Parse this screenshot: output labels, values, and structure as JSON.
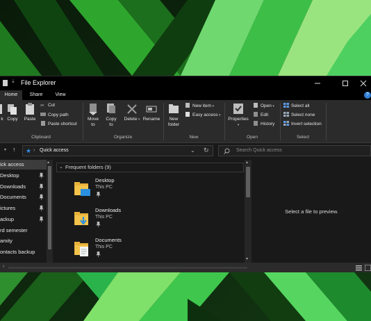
{
  "window": {
    "title": "File Explorer"
  },
  "tabs": [
    "Home",
    "Share",
    "View"
  ],
  "ribbon": {
    "clipboard": {
      "buttons": [
        "k",
        "Copy",
        "Paste"
      ],
      "small": [
        "Cut",
        "Copy path",
        "Paste shortcut"
      ],
      "group": "Clipboard"
    },
    "organize": {
      "move_to": [
        "Move",
        "to"
      ],
      "copy_to": [
        "Copy",
        "to"
      ],
      "delete": "Delete",
      "rename": "Rename",
      "group": "Organize"
    },
    "new": {
      "new_folder": [
        "New",
        "folder"
      ],
      "new_item": "New item",
      "easy_access": "Easy access",
      "group": "New"
    },
    "open": {
      "properties": "Properties",
      "small": [
        "Open",
        "Edit",
        "History"
      ],
      "group": "Open"
    },
    "select": {
      "small": [
        "Select all",
        "Select none",
        "Invert selection"
      ],
      "group": "Select"
    }
  },
  "address": {
    "path": "Quick access",
    "search_placeholder": "Search Quick access"
  },
  "nav": {
    "items": [
      {
        "label": "ick access",
        "selected": true,
        "pinned": false
      },
      {
        "label": "Desktop",
        "selected": false,
        "pinned": true
      },
      {
        "label": "Downloads",
        "selected": false,
        "pinned": true
      },
      {
        "label": "Documents",
        "selected": false,
        "pinned": true
      },
      {
        "label": "ictures",
        "selected": false,
        "pinned": true
      },
      {
        "label": "ackup",
        "selected": false,
        "pinned": true
      },
      {
        "label": "rd semester",
        "selected": false,
        "pinned": false
      },
      {
        "label": "amity",
        "selected": false,
        "pinned": false
      },
      {
        "label": "ontacts backup",
        "selected": false,
        "pinned": false
      }
    ]
  },
  "content": {
    "group_header": "Frequent folders (9)",
    "folders": [
      {
        "name": "Desktop",
        "location": "This PC",
        "icon": "desktop-folder-icon"
      },
      {
        "name": "Downloads",
        "location": "This PC",
        "icon": "downloads-folder-icon"
      },
      {
        "name": "Documents",
        "location": "This PC",
        "icon": "documents-folder-icon"
      }
    ]
  },
  "preview": {
    "message": "Select a file to preview."
  },
  "colors": {
    "accent": "#2f7fd8",
    "folder": "#f3c44c",
    "window_bg": "#191919",
    "ribbon_bg": "#2b2b2b"
  }
}
